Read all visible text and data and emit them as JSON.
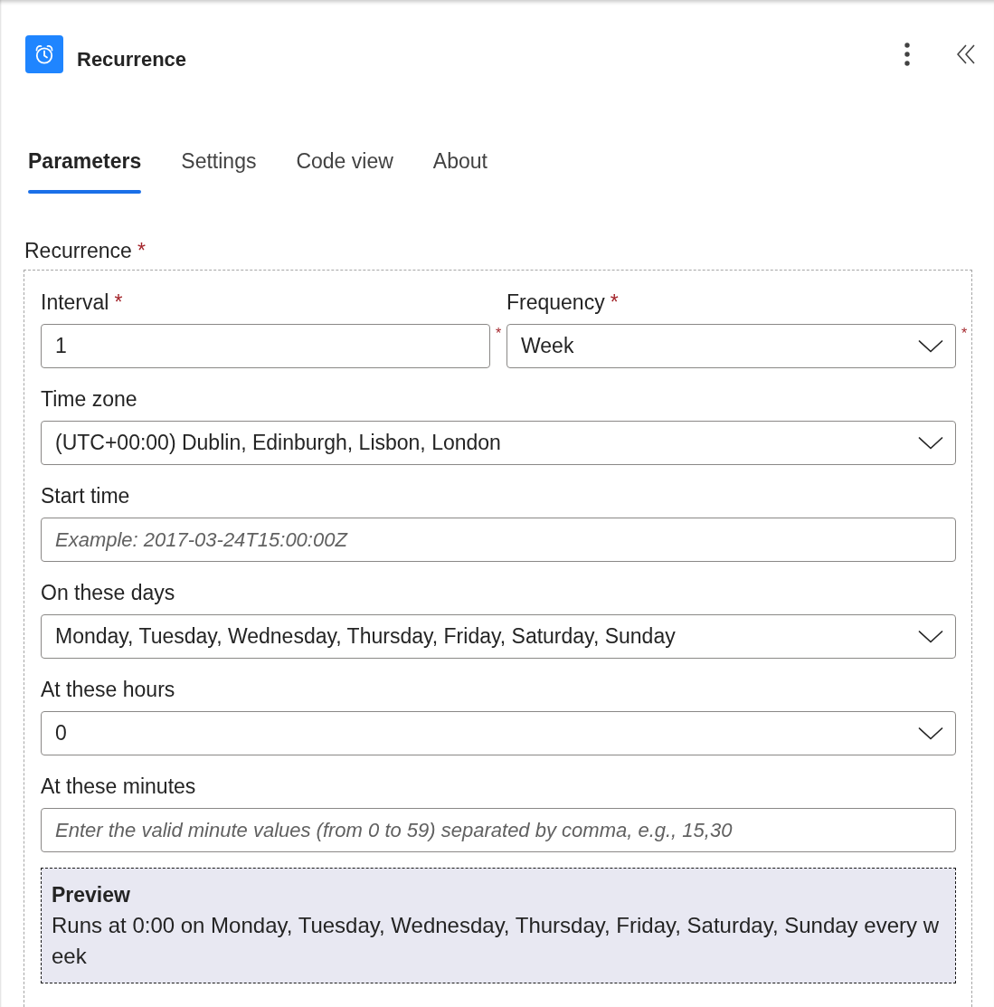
{
  "header": {
    "title": "Recurrence"
  },
  "tabs": [
    {
      "label": "Parameters",
      "selected": true
    },
    {
      "label": "Settings",
      "selected": false
    },
    {
      "label": "Code view",
      "selected": false
    },
    {
      "label": "About",
      "selected": false
    }
  ],
  "recurrence": {
    "label": "Recurrence",
    "label_mark": "*",
    "rows": [
      {
        "fields": [
          {
            "kind": "text",
            "label": "Interval",
            "label_mark": "*",
            "value": "1",
            "side_mark": "*"
          },
          {
            "kind": "dropdown",
            "label": "Frequency",
            "label_mark": "*",
            "value": "Week",
            "side_mark": "*"
          }
        ]
      },
      {
        "fields": [
          {
            "kind": "dropdown",
            "label": "Time zone",
            "value": "(UTC+00:00) Dublin, Edinburgh, Lisbon, London"
          }
        ]
      },
      {
        "fields": [
          {
            "kind": "text",
            "label": "Start time",
            "placeholder": "Example: 2017-03-24T15:00:00Z"
          }
        ]
      },
      {
        "fields": [
          {
            "kind": "dropdown",
            "label": "On these days",
            "value": "Monday, Tuesday, Wednesday, Thursday, Friday, Saturday, Sunday"
          }
        ]
      },
      {
        "fields": [
          {
            "kind": "dropdown",
            "label": "At these hours",
            "value": "0"
          }
        ]
      },
      {
        "fields": [
          {
            "kind": "text",
            "label": "At these minutes",
            "placeholder": "Enter the valid minute values (from 0 to 59) separated by comma, e.g., 15,30"
          }
        ]
      }
    ],
    "preview": {
      "title": "Preview",
      "text": "Runs at 0:00 on Monday, Tuesday, Wednesday, Thursday, Friday, Saturday, Sunday every week"
    }
  }
}
